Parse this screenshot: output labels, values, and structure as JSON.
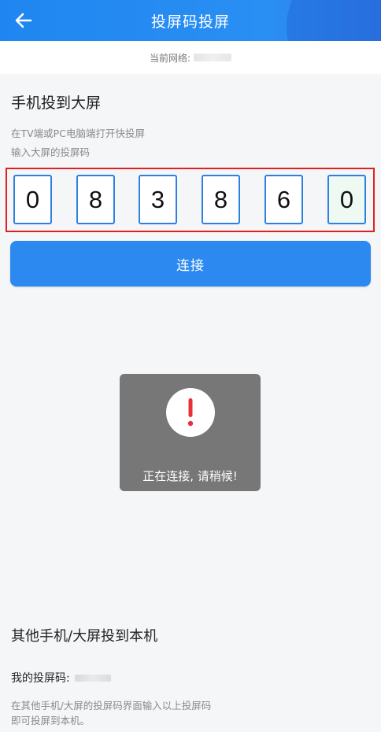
{
  "header": {
    "title": "投屏码投屏",
    "back_icon": "arrow-left-icon"
  },
  "network": {
    "label": "当前网络: "
  },
  "screen_cast": {
    "title": "手机投到大屏",
    "hint_line1": "在TV端或PC电脑端打开快投屏",
    "hint_line2": "输入大屏的投屏码",
    "digits": [
      "0",
      "8",
      "3",
      "8",
      "6",
      "0"
    ],
    "connect_label": "连接"
  },
  "toast": {
    "icon": "exclamation-icon",
    "message": "正在连接, 请稍候!"
  },
  "receive": {
    "title": "其他手机/大屏投到本机",
    "my_code_label": "我的投屏码: ",
    "hint_line1": "在其他手机/大屏的投屏码界面输入以上投屏码",
    "hint_line2": "即可投屏到本机。"
  },
  "colors": {
    "primary": "#2c89f0",
    "highlight_border": "#e02020",
    "alert_red": "#e8303a"
  }
}
